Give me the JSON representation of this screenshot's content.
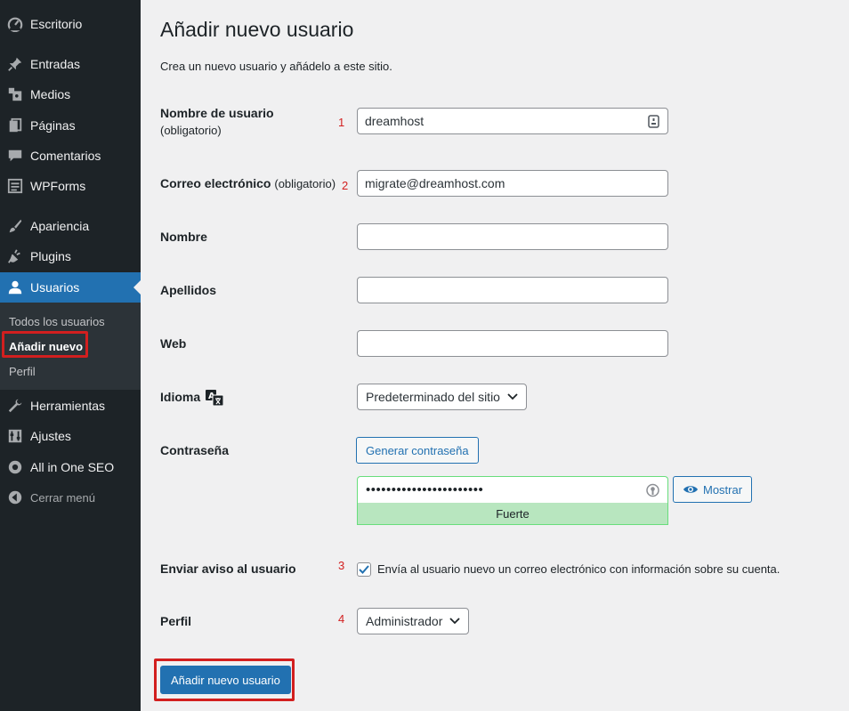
{
  "sidebar": {
    "items": [
      {
        "label": "Escritorio",
        "icon": "dashboard-icon"
      },
      {
        "label": "Entradas",
        "icon": "pin-icon"
      },
      {
        "label": "Medios",
        "icon": "media-icon"
      },
      {
        "label": "Páginas",
        "icon": "pages-icon"
      },
      {
        "label": "Comentarios",
        "icon": "comment-icon"
      },
      {
        "label": "WPForms",
        "icon": "forms-icon"
      },
      {
        "label": "Apariencia",
        "icon": "brush-icon"
      },
      {
        "label": "Plugins",
        "icon": "plug-icon"
      },
      {
        "label": "Usuarios",
        "icon": "user-icon"
      },
      {
        "label": "Herramientas",
        "icon": "wrench-icon"
      },
      {
        "label": "Ajustes",
        "icon": "settings-icon"
      },
      {
        "label": "All in One SEO",
        "icon": "seo-icon"
      },
      {
        "label": "Cerrar menú",
        "icon": "collapse-icon"
      }
    ],
    "submenu": [
      "Todos los usuarios",
      "Añadir nuevo",
      "Perfil"
    ]
  },
  "page": {
    "title": "Añadir nuevo usuario",
    "description": "Crea un nuevo usuario y añádelo a este sitio."
  },
  "form": {
    "username": {
      "label": "Nombre de usuario",
      "required": "(obligatorio)",
      "value": "dreamhost",
      "marker": "1"
    },
    "email": {
      "label": "Correo electrónico",
      "required": "(obligatorio)",
      "value": "migrate@dreamhost.com",
      "marker": "2"
    },
    "first_name": {
      "label": "Nombre",
      "value": ""
    },
    "last_name": {
      "label": "Apellidos",
      "value": ""
    },
    "website": {
      "label": "Web",
      "value": ""
    },
    "language": {
      "label": "Idioma",
      "selected": "Predeterminado del sitio"
    },
    "password": {
      "label": "Contraseña",
      "generate_label": "Generar contraseña",
      "masked_value": "•••••••••••••••••••••••",
      "strength": "Fuerte",
      "show_label": "Mostrar"
    },
    "notify": {
      "label": "Enviar aviso al usuario",
      "checkbox_label": "Envía al usuario nuevo un correo electrónico con información sobre su cuenta.",
      "checked": true,
      "marker": "3"
    },
    "role": {
      "label": "Perfil",
      "selected": "Administrador",
      "marker": "4"
    },
    "submit_label": "Añadir nuevo usuario"
  },
  "colors": {
    "sidebar_bg": "#1d2327",
    "accent": "#2271b1",
    "highlight_red": "#d21f1f",
    "strength_bg": "#b8e6bf"
  }
}
